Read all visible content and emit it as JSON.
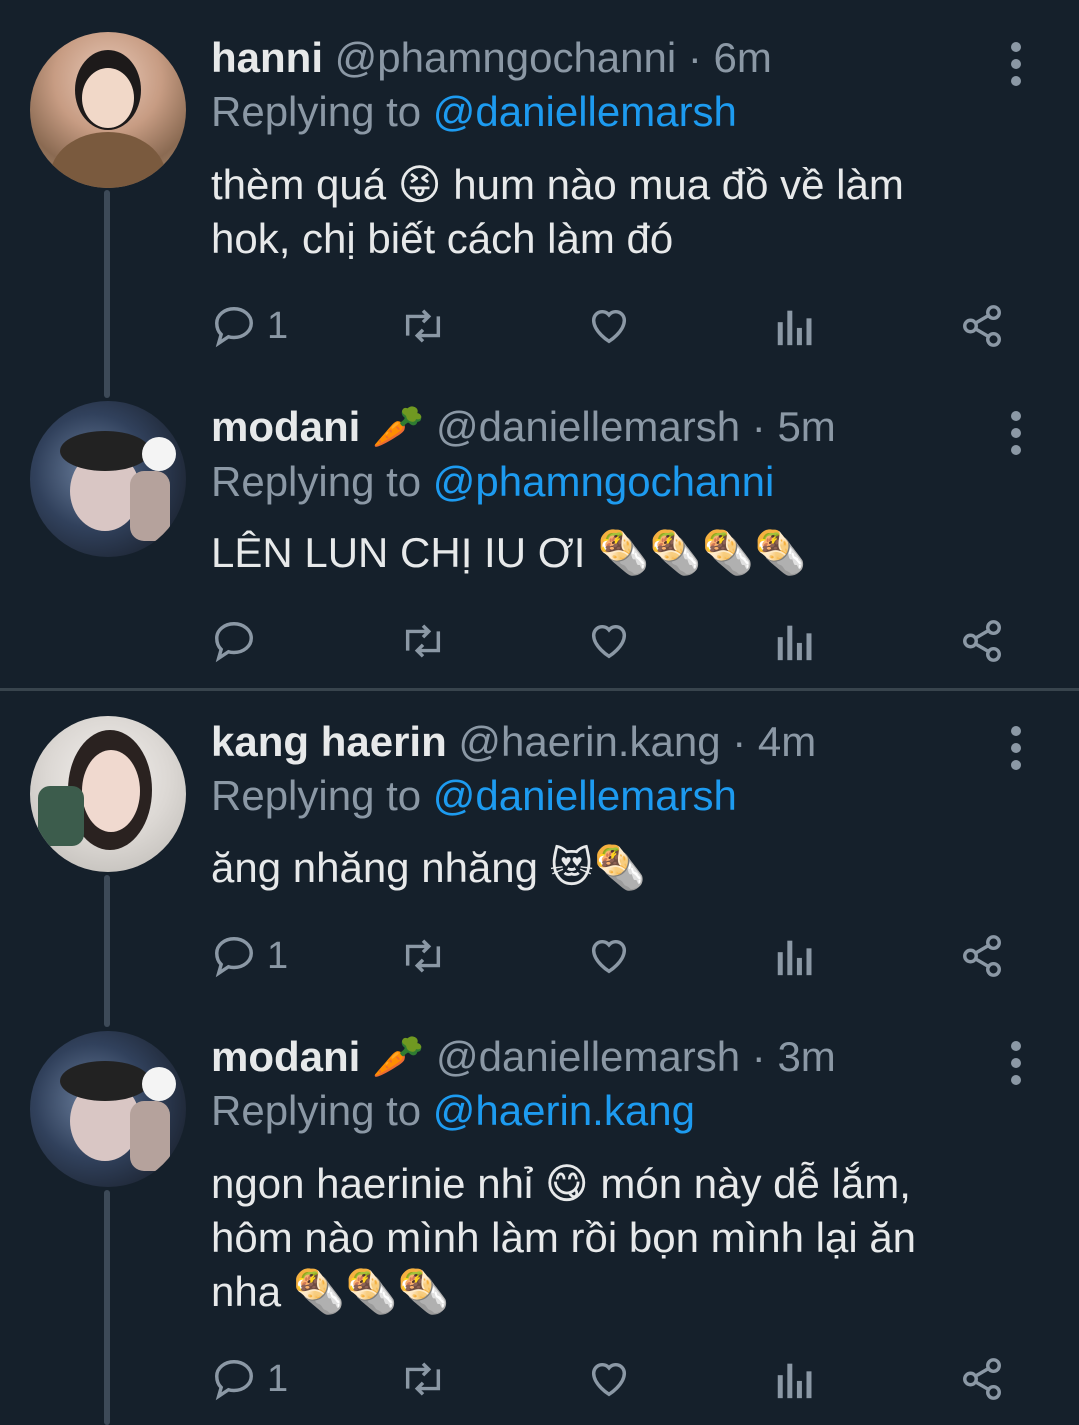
{
  "tweets": [
    {
      "name": "hanni",
      "handle": "@phamngochanni",
      "time": "6m",
      "reply_prefix": "Replying to",
      "reply_to": "@daniellemarsh",
      "text_lines": [
        "thèm quá 😝 hum nào mua đồ về làm",
        "hok, chị biết cách làm đó"
      ],
      "reply_count": "1"
    },
    {
      "name": "modani 🥕",
      "handle": "@daniellemarsh",
      "time": "5m",
      "reply_prefix": "Replying to",
      "reply_to": "@phamngochanni",
      "text_lines": [
        "LÊN LUN CHỊ IU ƠI 🌯🌯🌯🌯"
      ],
      "reply_count": ""
    },
    {
      "name": "kang haerin",
      "handle": "@haerin.kang",
      "time": "4m",
      "reply_prefix": "Replying to",
      "reply_to": "@daniellemarsh",
      "text_lines": [
        "ăng nhăng nhăng 😻🌯"
      ],
      "reply_count": "1"
    },
    {
      "name": "modani 🥕",
      "handle": "@daniellemarsh",
      "time": "3m",
      "reply_prefix": "Replying to",
      "reply_to": "@haerin.kang",
      "text_lines": [
        "ngon haerinie nhỉ 😋 món này dễ lắm,",
        "hôm nào mình làm rồi bọn mình lại ăn",
        "nha 🌯🌯🌯"
      ],
      "reply_count": "1"
    }
  ],
  "separator": " · ",
  "icons": [
    "reply-icon",
    "retweet-icon",
    "like-icon",
    "analytics-icon",
    "share-icon",
    "more-icon"
  ],
  "colors": {
    "background": "#15202b",
    "accent": "#1d9bf0",
    "muted": "#8b98a5",
    "text": "#e7e9ea"
  }
}
